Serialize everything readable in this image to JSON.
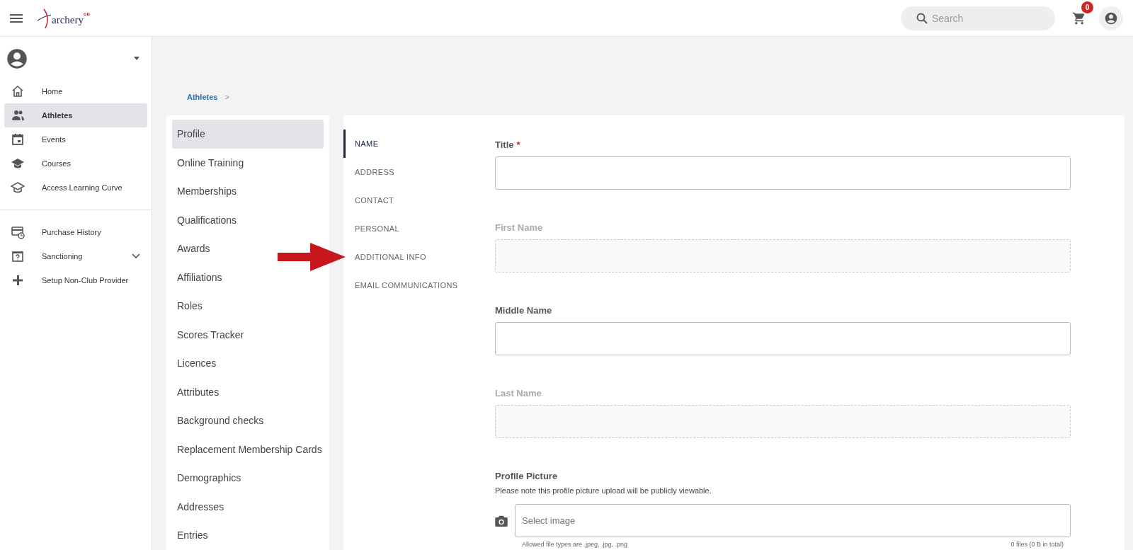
{
  "header": {
    "logo": {
      "name": "archery",
      "suffix": "GB"
    },
    "search": {
      "placeholder": "Search"
    },
    "cart": {
      "count": "0"
    }
  },
  "sidebar": {
    "groups": [
      [
        {
          "label": "Home",
          "selected": false
        },
        {
          "label": "Athletes",
          "selected": true
        },
        {
          "label": "Events",
          "selected": false
        },
        {
          "label": "Courses",
          "selected": false
        },
        {
          "label": "Access Learning Curve",
          "selected": false
        }
      ],
      [
        {
          "label": "Purchase History",
          "selected": false
        },
        {
          "label": "Sanctioning",
          "selected": false,
          "expandable": true
        },
        {
          "label": "Setup Non-Club Provider",
          "selected": false
        }
      ]
    ]
  },
  "breadcrumb": {
    "link": "Athletes",
    "separator": ">"
  },
  "section_menu": [
    {
      "label": "Profile",
      "selected": true
    },
    {
      "label": "Online Training",
      "selected": false
    },
    {
      "label": "Memberships",
      "selected": false
    },
    {
      "label": "Qualifications",
      "selected": false
    },
    {
      "label": "Awards",
      "selected": false
    },
    {
      "label": "Affiliations",
      "selected": false
    },
    {
      "label": "Roles",
      "selected": false
    },
    {
      "label": "Scores Tracker",
      "selected": false
    },
    {
      "label": "Licences",
      "selected": false
    },
    {
      "label": "Attributes",
      "selected": false
    },
    {
      "label": "Background checks",
      "selected": false
    },
    {
      "label": "Replacement Membership Cards",
      "selected": false
    },
    {
      "label": "Demographics",
      "selected": false
    },
    {
      "label": "Addresses",
      "selected": false
    },
    {
      "label": "Entries",
      "selected": false
    }
  ],
  "profile_tabs": [
    {
      "label": "NAME",
      "selected": true
    },
    {
      "label": "ADDRESS",
      "selected": false
    },
    {
      "label": "CONTACT",
      "selected": false
    },
    {
      "label": "PERSONAL",
      "selected": false
    },
    {
      "label": "ADDITIONAL INFO",
      "selected": false,
      "pointed_at": true
    },
    {
      "label": "EMAIL COMMUNICATIONS",
      "selected": false
    }
  ],
  "fields": [
    {
      "kind": "text",
      "label": "Title",
      "required_mark": "*",
      "disabled": false
    },
    {
      "kind": "text",
      "label": "First Name",
      "disabled": true
    },
    {
      "kind": "text",
      "label": "Middle Name",
      "disabled": false
    },
    {
      "kind": "text",
      "label": "Last Name",
      "disabled": true
    },
    {
      "kind": "file",
      "label": "Profile Picture",
      "note": "Please note this profile picture upload will be publicly viewable.",
      "placeholder": "Select image",
      "hint": "Allowed file types are .jpeg, .jpg, .png",
      "count": "0 files (0 B in total)"
    }
  ]
}
